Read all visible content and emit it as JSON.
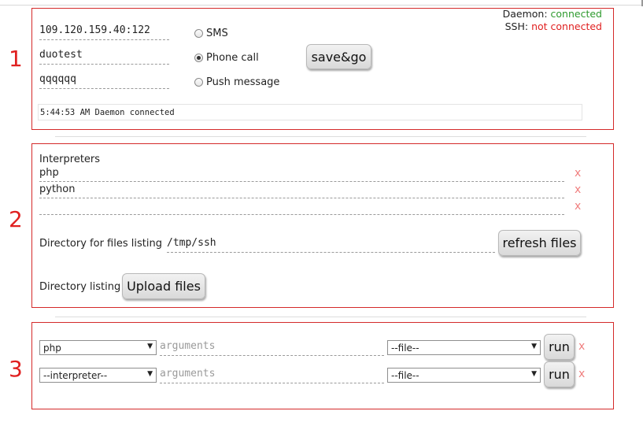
{
  "status": {
    "daemon_label": "Daemon:",
    "daemon_value": "connected",
    "ssh_label": "SSH:",
    "ssh_value": "not connected",
    "connected_color": "#2e9a2e",
    "disconnected_color": "#e02020"
  },
  "sections": {
    "one": "1",
    "two": "2",
    "three": "3"
  },
  "connection": {
    "host": "109.120.159.40:122",
    "user": "duotest",
    "password": "qqqqqq",
    "methods": [
      {
        "label": "SMS",
        "checked": false
      },
      {
        "label": "Phone call",
        "checked": true
      },
      {
        "label": "Push message",
        "checked": false
      }
    ],
    "save_button": "save&go",
    "log": "5:44:53 AM Daemon connected"
  },
  "interpreters": {
    "title": "Interpreters",
    "items": [
      "php",
      "python",
      ""
    ],
    "remove_label": "x",
    "dir_label": "Directory for files listing",
    "dir_value": "/tmp/ssh",
    "refresh_button": "refresh files",
    "listing_label": "Directory listing",
    "upload_button": "Upload files"
  },
  "runs": {
    "rows": [
      {
        "interpreter": "php",
        "arguments_placeholder": "arguments",
        "file": "--file--",
        "run_label": "run",
        "remove_label": "x"
      },
      {
        "interpreter": "--interpreter--",
        "arguments_placeholder": "arguments",
        "file": "--file--",
        "run_label": "run",
        "remove_label": "x"
      }
    ]
  }
}
